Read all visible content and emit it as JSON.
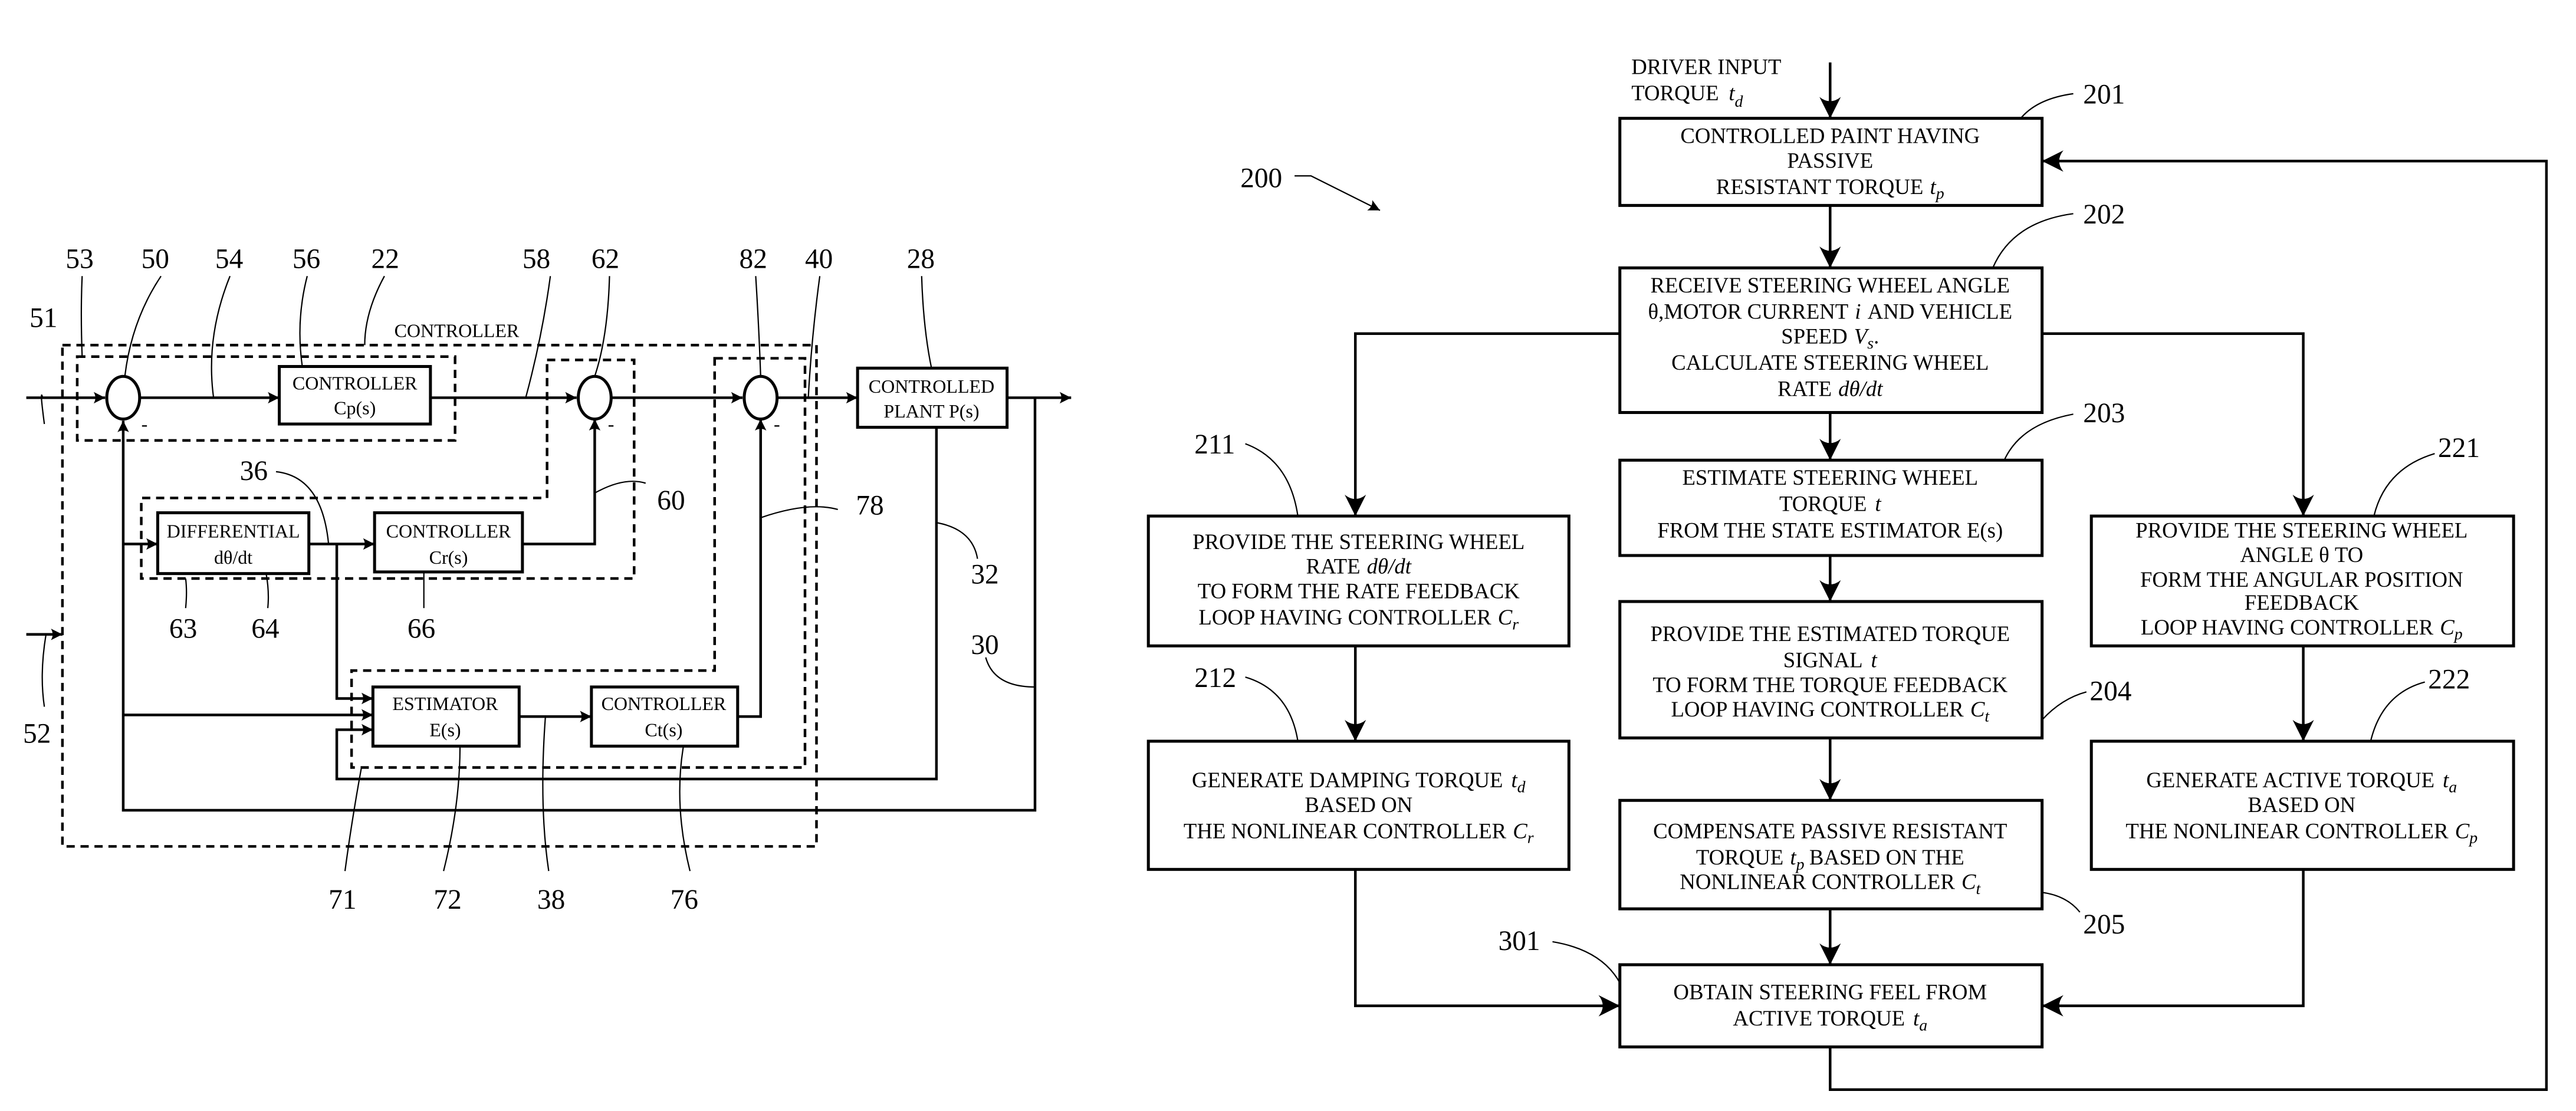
{
  "left_diagram": {
    "title": "CONTROLLER",
    "blocks": {
      "cp": {
        "line1": "CONTROLLER",
        "line2": "Cp(s)"
      },
      "cr": {
        "line1": "CONTROLLER",
        "line2": "Cr(s)"
      },
      "ct": {
        "line1": "CONTROLLER",
        "line2": "Ct(s)"
      },
      "diff": {
        "line1": "DIFFERENTIAL",
        "line2": "dθ/dt"
      },
      "est": {
        "line1": "ESTIMATOR",
        "line2": "E(s)"
      },
      "plant": {
        "line1": "CONTROLLED",
        "line2": "PLANT P(s)"
      }
    },
    "minus_sign": "-",
    "refs": {
      "r53": "53",
      "r50": "50",
      "r54": "54",
      "r56": "56",
      "r22": "22",
      "r58": "58",
      "r62": "62",
      "r82": "82",
      "r40": "40",
      "r28": "28",
      "r51": "51",
      "r36": "36",
      "r60": "60",
      "r78": "78",
      "r32": "32",
      "r30": "30",
      "r52": "52",
      "r63": "63",
      "r64": "64",
      "r66": "66",
      "r71": "71",
      "r72": "72",
      "r38": "38",
      "r76": "76"
    }
  },
  "flowchart": {
    "ref_200": "200",
    "input_label": {
      "line1": "DRIVER INPUT",
      "line2": "TORQUE",
      "var": "t",
      "sub": "d"
    },
    "boxes": {
      "b201": {
        "ref": "201",
        "lines": [
          "CONTROLLED PAINT HAVING",
          "PASSIVE",
          "RESISTANT TORQUE"
        ],
        "var": "t",
        "sub": "p"
      },
      "b202": {
        "ref": "202",
        "lines": [
          "RECEIVE STEERING WHEEL ANGLE",
          "θ,MOTOR CURRENT",
          "AND VEHICLE",
          "SPEED",
          "CALCULATE STEERING WHEEL",
          "RATE"
        ],
        "i": "i",
        "vs": "V",
        "vs_sub": "s",
        "rate": "dθ/dt"
      },
      "b203": {
        "ref": "203",
        "lines": [
          "ESTIMATE STEERING WHEEL",
          "TORQUE",
          "FROM THE STATE ESTIMATOR  E(s)"
        ],
        "var": "t"
      },
      "b204": {
        "ref": "204",
        "lines": [
          "PROVIDE THE ESTIMATED TORQUE",
          "SIGNAL",
          "TO FORM THE TORQUE FEEDBACK",
          "LOOP HAVING CONTROLLER"
        ],
        "var": "t",
        "ctrl": "C",
        "ctrl_sub": "t"
      },
      "b205": {
        "ref": "205",
        "lines": [
          "COMPENSATE PASSIVE RESISTANT",
          "TORQUE",
          "BASED ON THE",
          "NONLINEAR CONTROLLER"
        ],
        "var": "t",
        "sub": "p",
        "ctrl": "C",
        "ctrl_sub": "t"
      },
      "b211": {
        "ref": "211",
        "lines": [
          "PROVIDE THE STEERING WHEEL",
          "RATE",
          "TO FORM THE RATE FEEDBACK",
          "LOOP HAVING CONTROLLER"
        ],
        "rate": "dθ/dt",
        "ctrl": "C",
        "ctrl_sub": "r"
      },
      "b212": {
        "ref": "212",
        "lines": [
          "GENERATE DAMPING TORQUE",
          "BASED ON",
          "THE NONLINEAR CONTROLLER"
        ],
        "var": "t",
        "sub": "d",
        "ctrl": "C",
        "ctrl_sub": "r"
      },
      "b221": {
        "ref": "221",
        "lines": [
          "PROVIDE THE STEERING WHEEL",
          "ANGLE θ TO",
          "FORM THE ANGULAR POSITION",
          "FEEDBACK",
          "LOOP HAVING CONTROLLER"
        ],
        "ctrl": "C",
        "ctrl_sub": "p"
      },
      "b222": {
        "ref": "222",
        "lines": [
          "GENERATE ACTIVE TORQUE",
          "BASED ON",
          "THE NONLINEAR CONTROLLER"
        ],
        "var": "t",
        "sub": "a",
        "ctrl": "C",
        "ctrl_sub": "p"
      },
      "b301": {
        "ref": "301",
        "lines": [
          "OBTAIN STEERING FEEL FROM",
          "ACTIVE TORQUE"
        ],
        "var": "t",
        "sub": "a"
      }
    }
  }
}
